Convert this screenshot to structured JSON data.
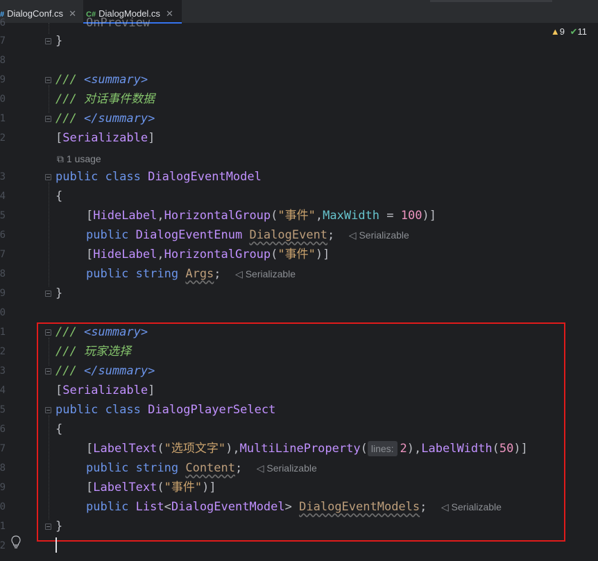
{
  "tabs": [
    {
      "lang": "#",
      "label": "DialogConf.cs",
      "active": false
    },
    {
      "lang": "C#",
      "label": "DialogModel.cs",
      "active": true
    }
  ],
  "inspections": {
    "warnings": "9",
    "ok": "11"
  },
  "line_numbers": [
    "6",
    "7",
    "8",
    "9",
    "0",
    "1",
    "2",
    "3",
    "4",
    "5",
    "6",
    "7",
    "8",
    "9",
    "0",
    "1",
    "2",
    "3",
    "4",
    "5",
    "6",
    "7",
    "8",
    "9",
    "0",
    "1",
    "2"
  ],
  "code": {
    "l0_partial": "OnPreview",
    "close_brace": "}",
    "open_brace": "{",
    "doc_prefix": "/// ",
    "summary_open": "<summary>",
    "summary_close": "</summary>",
    "comment_event": "对话事件数据",
    "comment_select": "玩家选择",
    "serializable_attr": "Serializable",
    "usage_hint": "1 usage",
    "kw_public": "public",
    "kw_class": "class",
    "kw_string": "string",
    "class1": "DialogEventModel",
    "class2": "DialogPlayerSelect",
    "attr_hide": "HideLabel",
    "attr_hgroup": "HorizontalGroup",
    "str_event": "\"事件\"",
    "prop_maxwidth": "MaxWidth",
    "num_100": "100",
    "type_enum": "DialogEventEnum",
    "field_event": "DialogEvent",
    "field_args": "Args",
    "attr_labeltext": "LabelText",
    "str_option": "\"选项文字\"",
    "attr_multiline": "MultiLineProperty",
    "inlay_lines": "lines:",
    "num_2": "2",
    "attr_labelwidth": "LabelWidth",
    "num_50": "50",
    "field_content": "Content",
    "type_list": "List",
    "field_models": "DialogEventModels",
    "hint_serializable": "Serializable"
  },
  "colors": {
    "background": "#1e1f22",
    "keyword": "#6c95eb",
    "attribute": "#c191ff",
    "string": "#c9a26d",
    "number": "#ed94c0",
    "comment": "#85c46c",
    "highlight_box": "#e01b1b"
  }
}
